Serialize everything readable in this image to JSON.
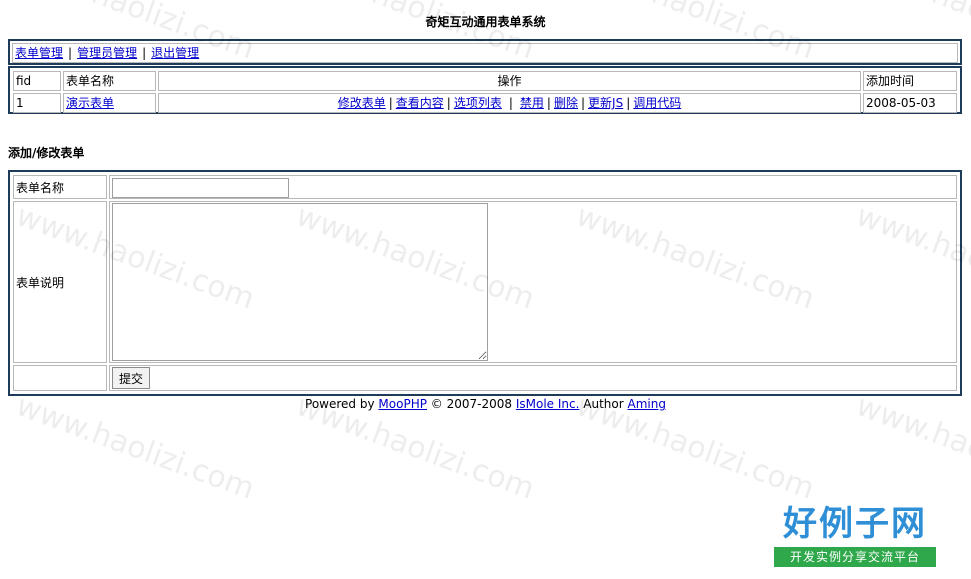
{
  "page": {
    "title": "奇矩互动通用表单系统"
  },
  "menu": {
    "items": [
      "表单管理",
      "管理员管理",
      "退出管理"
    ],
    "separator": "|"
  },
  "form_list": {
    "headers": [
      "fid",
      "表单名称",
      "操作",
      "添加时间"
    ],
    "rows": [
      {
        "fid": "1",
        "name": "演示表单",
        "actions": [
          "修改表单",
          "查看内容",
          "选项列表",
          "禁用",
          "删除",
          "更新JS",
          "调用代码"
        ],
        "date": "2008-05-03"
      }
    ]
  },
  "edit_form": {
    "section_title": "添加/修改表单",
    "name_label": "表单名称",
    "name_value": "",
    "desc_label": "表单说明",
    "desc_value": "",
    "submit_label": "提交"
  },
  "footer": {
    "powered_by": "Powered by",
    "moophp": "MooPHP",
    "copyright": "© 2007-2008",
    "company": "IsMole Inc.",
    "author_label": "Author",
    "author": "Aming"
  },
  "watermark": {
    "text": "www.haolizi.com"
  },
  "logo": {
    "main": "好例子网",
    "sub": "开发实例分享交流平台",
    "color_main": "#2e8fd6",
    "color_sub_bg": "#2ea84a"
  },
  "colors": {
    "link": "#0000cc",
    "border_dark": "#1f3b5a",
    "border_light": "#b8b8b8"
  }
}
